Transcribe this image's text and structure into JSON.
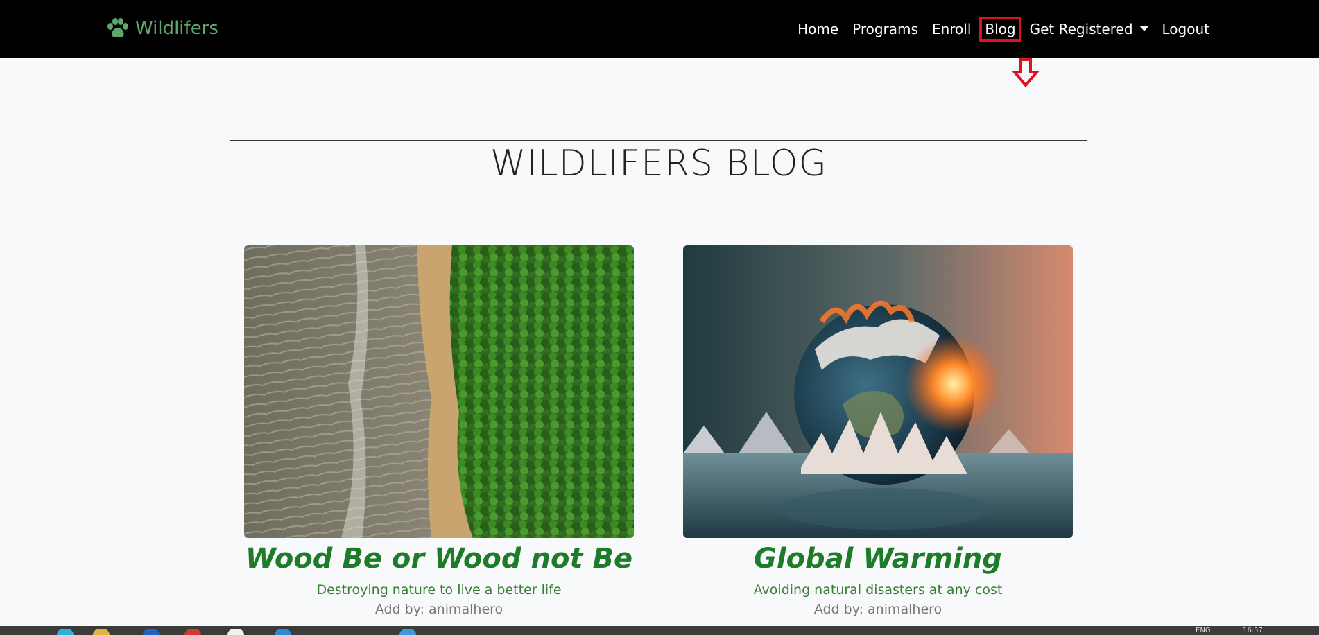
{
  "brand": {
    "name": "Wildlifers",
    "icon": "paw-icon",
    "color": "#5fa86d"
  },
  "nav": {
    "items": [
      {
        "label": "Home"
      },
      {
        "label": "Programs"
      },
      {
        "label": "Enroll"
      },
      {
        "label": "Blog",
        "highlighted": true
      },
      {
        "label": "Get Registered",
        "dropdown": true
      },
      {
        "label": "Logout"
      }
    ]
  },
  "annotation": {
    "icon": "down-arrow-icon",
    "color": "#e0101f"
  },
  "page": {
    "title": "WILDLIFERS BLOG"
  },
  "posts": [
    {
      "title": "Wood Be or Wood not Be",
      "subtitle": "Destroying nature to live a better life",
      "author": "Add by: animalhero",
      "image": "deforestation-aerial-image"
    },
    {
      "title": "Global Warming",
      "subtitle": "Avoiding natural disasters at any cost",
      "author": "Add by: animalhero",
      "image": "melting-earth-image"
    }
  ],
  "taskbar": {
    "language": "ENG",
    "time": "16:57"
  },
  "colors": {
    "post_title": "#1e7b2a",
    "post_subtitle": "#3a7d35",
    "navbar": "#000000",
    "background": "#f8f9fa"
  }
}
